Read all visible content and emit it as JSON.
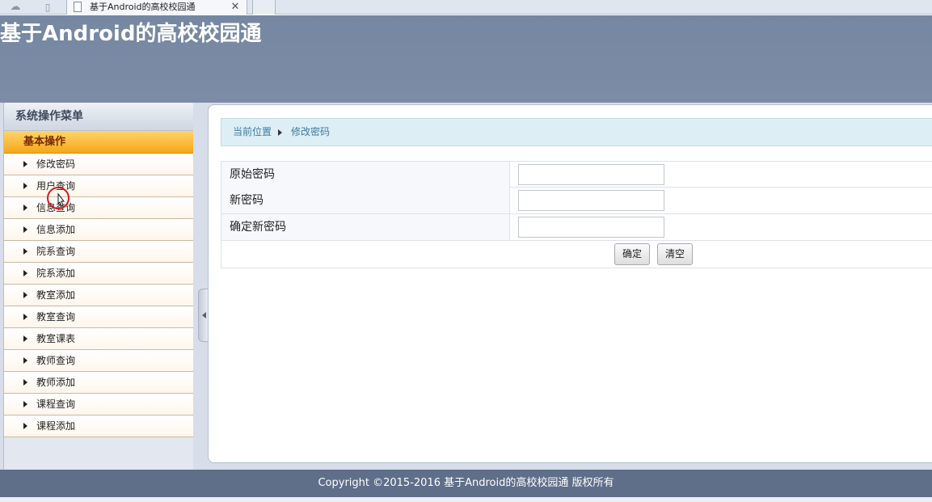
{
  "browser": {
    "tab_title": "基于Android的高校校园通",
    "close_glyph": "✕",
    "cloud_glyph": "☁",
    "phone_glyph": "▯"
  },
  "header": {
    "site_title": "基于Android的高校校园通"
  },
  "sidebar": {
    "menu_title": "系统操作菜单",
    "group_label": "基本操作",
    "items": [
      {
        "label": "修改密码"
      },
      {
        "label": "用户查询"
      },
      {
        "label": "信息查询"
      },
      {
        "label": "信息添加"
      },
      {
        "label": "院系查询"
      },
      {
        "label": "院系添加"
      },
      {
        "label": "教室添加"
      },
      {
        "label": "教室查询"
      },
      {
        "label": "教室课表"
      },
      {
        "label": "教师查询"
      },
      {
        "label": "教师添加"
      },
      {
        "label": "课程查询"
      },
      {
        "label": "课程添加"
      }
    ]
  },
  "breadcrumb": {
    "root": "当前位置",
    "current": "修改密码"
  },
  "form": {
    "fields": [
      {
        "label": "原始密码",
        "value": ""
      },
      {
        "label": "新密码",
        "value": ""
      },
      {
        "label": "确定新密码",
        "value": ""
      }
    ],
    "submit_label": "确定",
    "clear_label": "清空"
  },
  "footer": {
    "text": "Copyright ©2015-2016 基于Android的高校校园通 版权所有"
  },
  "colors": {
    "header_bg": "#7587a1",
    "group_bg": "#f6a61b",
    "footer_bg": "#5f6e89",
    "breadcrumb_bg": "#ddeef5"
  }
}
